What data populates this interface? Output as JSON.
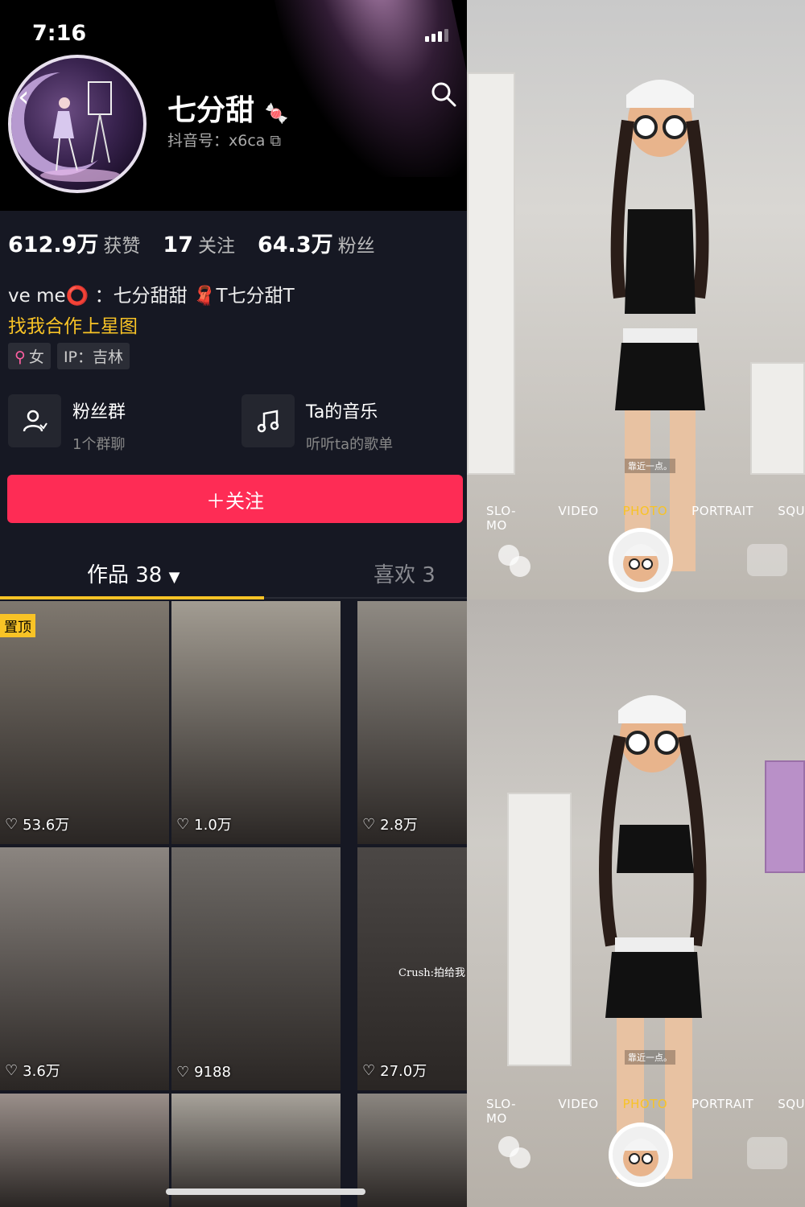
{
  "status_bar": {
    "time": "7:16"
  },
  "profile": {
    "name": "七分甜",
    "douyin_id": "抖音号：x6ca",
    "stats": [
      {
        "value": "612.9万",
        "label": "获赞"
      },
      {
        "value": "17",
        "label": "关注"
      },
      {
        "value": "64.3万",
        "label": "粉丝"
      }
    ],
    "bio": "ve me⭕ ：七分甜甜 🧣T七分甜T",
    "promo": "找我合作上星图",
    "tags": {
      "gender_icon": "⚲",
      "gender": "女",
      "ip": "IP：吉林"
    },
    "cards": [
      {
        "title": "粉丝群",
        "subtitle": "1个群聊",
        "icon": "fan-group-icon"
      },
      {
        "title": "Ta的音乐",
        "subtitle": "听听ta的歌单",
        "icon": "music-note-icon"
      }
    ],
    "follow_button": "＋关注",
    "tabs": {
      "works": "作品 38",
      "likes": "喜欢 3"
    },
    "pinned": "置顶",
    "grid_caption": "Crush:拍给我",
    "videos": [
      {
        "likes": "53.6万",
        "bg": "#7f786f"
      },
      {
        "likes": "1.0万",
        "bg": "#a29c92"
      },
      {
        "likes": "2.8万",
        "bg": "#8f8a83"
      },
      {
        "likes": "3.6万",
        "bg": "#8b8580"
      },
      {
        "likes": "9188",
        "bg": "#6e6a66"
      },
      {
        "likes": "27.0万",
        "bg": "#4b4745"
      },
      {
        "likes": "",
        "bg": "#9a8f8a"
      },
      {
        "likes": "",
        "bg": "#a7a29a"
      },
      {
        "likes": "",
        "bg": "#8b8680"
      }
    ]
  },
  "camera": {
    "hint": "靠近一点。",
    "modes": [
      "SLO-MO",
      "VIDEO",
      "PHOTO",
      "PORTRAIT",
      "SQU"
    ],
    "active_mode": "PHOTO",
    "accent": "#f8c326"
  }
}
